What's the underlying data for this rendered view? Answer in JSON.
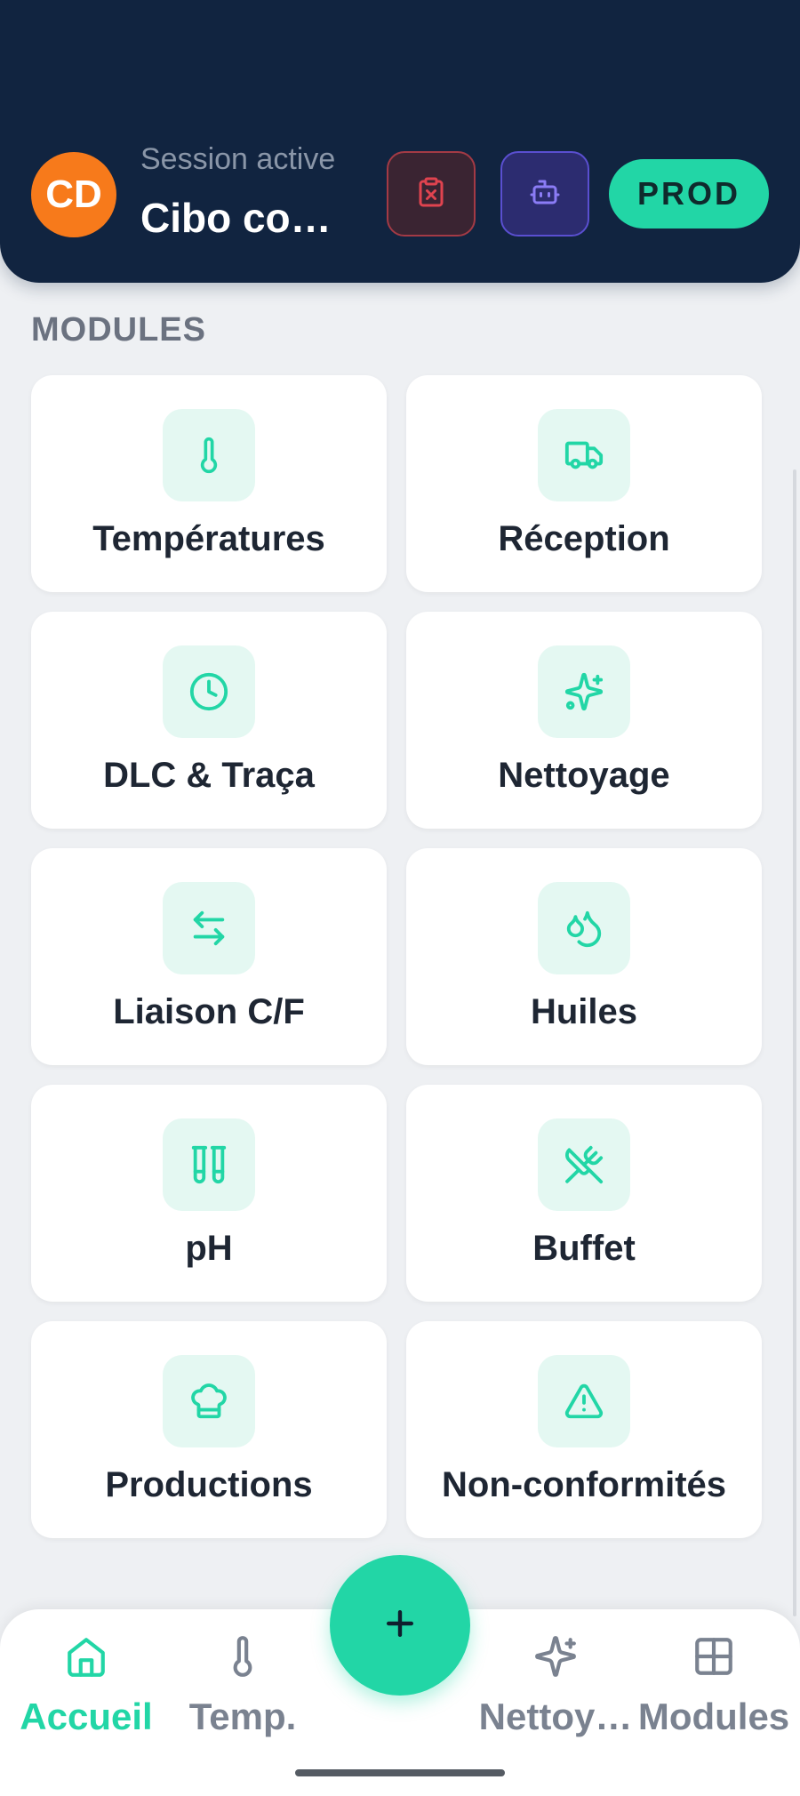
{
  "header": {
    "avatar_initials": "CD",
    "session_label": "Session active",
    "session_name": "Cibo con…",
    "env_badge": "PROD",
    "buttons": [
      {
        "icon": "clipboard-x-icon",
        "color": "#e0434f"
      },
      {
        "icon": "bot-icon",
        "color": "#8b7cf6"
      }
    ]
  },
  "modules": {
    "title": "MODULES",
    "items": [
      {
        "label": "Températures",
        "icon": "thermometer-icon"
      },
      {
        "label": "Réception",
        "icon": "truck-icon"
      },
      {
        "label": "DLC & Traça",
        "icon": "clock-icon"
      },
      {
        "label": "Nettoyage",
        "icon": "sparkles-icon"
      },
      {
        "label": "Liaison C/F",
        "icon": "arrows-exchange-icon"
      },
      {
        "label": "Huiles",
        "icon": "droplets-icon"
      },
      {
        "label": "pH",
        "icon": "test-tubes-icon"
      },
      {
        "label": "Buffet",
        "icon": "utensils-crossed-icon"
      },
      {
        "label": "Productions",
        "icon": "chef-hat-icon"
      },
      {
        "label": "Non-conformités",
        "icon": "warning-triangle-icon"
      }
    ]
  },
  "fab": {
    "icon": "plus-icon"
  },
  "bottom_nav": {
    "items": [
      {
        "label": "Accueil",
        "icon": "home-icon",
        "active": true
      },
      {
        "label": "Temp.",
        "icon": "thermometer-icon"
      },
      {
        "label": "Nettoy…",
        "icon": "sparkles-icon"
      },
      {
        "label": "Modules",
        "icon": "grid-icon"
      }
    ]
  },
  "colors": {
    "accent": "#22d6a6",
    "header_bg": "#112440",
    "avatar": "#f77a1b",
    "text": "#1e2633",
    "muted": "#7a8290"
  }
}
